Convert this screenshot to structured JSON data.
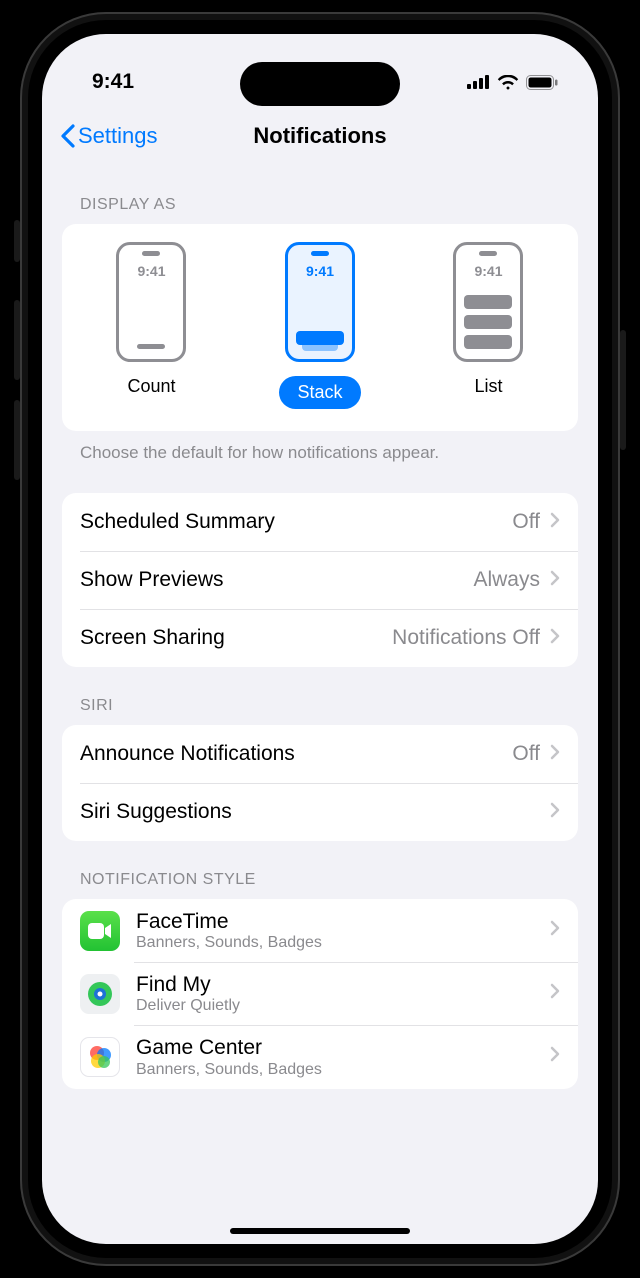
{
  "statusbar": {
    "time": "9:41"
  },
  "nav": {
    "back_label": "Settings",
    "title": "Notifications"
  },
  "display_as": {
    "header": "DISPLAY AS",
    "options": [
      {
        "label": "Count",
        "preview_time": "9:41"
      },
      {
        "label": "Stack",
        "preview_time": "9:41"
      },
      {
        "label": "List",
        "preview_time": "9:41"
      }
    ],
    "selected": "Stack",
    "footer": "Choose the default for how notifications appear."
  },
  "general": {
    "rows": [
      {
        "label": "Scheduled Summary",
        "value": "Off"
      },
      {
        "label": "Show Previews",
        "value": "Always"
      },
      {
        "label": "Screen Sharing",
        "value": "Notifications Off"
      }
    ]
  },
  "siri": {
    "header": "SIRI",
    "rows": [
      {
        "label": "Announce Notifications",
        "value": "Off"
      },
      {
        "label": "Siri Suggestions",
        "value": ""
      }
    ]
  },
  "style": {
    "header": "NOTIFICATION STYLE",
    "apps": [
      {
        "name": "FaceTime",
        "sub": "Banners, Sounds, Badges",
        "icon": "facetime"
      },
      {
        "name": "Find My",
        "sub": "Deliver Quietly",
        "icon": "findmy"
      },
      {
        "name": "Game Center",
        "sub": "Banners, Sounds, Badges",
        "icon": "gamecenter"
      }
    ]
  },
  "colors": {
    "accent": "#007aff"
  }
}
